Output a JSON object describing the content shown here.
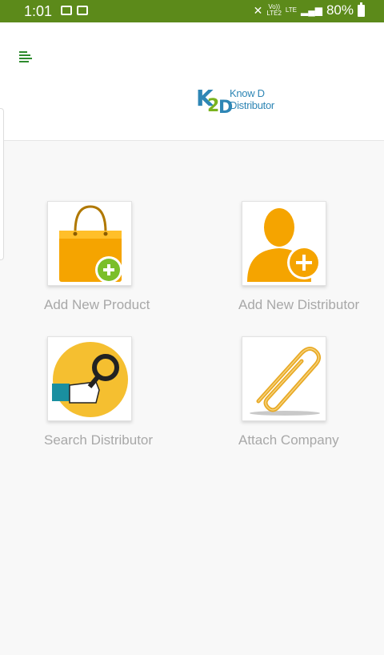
{
  "statusbar": {
    "time": "1:01",
    "volte": "Vo))",
    "lte": "LTE",
    "lte2": "LTE2",
    "battery": "80%"
  },
  "app": {
    "logo_k": "K",
    "logo_2": "2",
    "logo_d": "D",
    "logo_text": "Know D Distributor"
  },
  "tiles": [
    {
      "label": "Add New Product"
    },
    {
      "label": "Add New Distributor"
    },
    {
      "label": "Search Distributor"
    },
    {
      "label": "Attach Company"
    }
  ],
  "colors": {
    "statusbar": "#5c8a1a",
    "accent_orange": "#f5a400",
    "accent_green": "#7bbf2a",
    "label_gray": "#a8a8a8"
  }
}
